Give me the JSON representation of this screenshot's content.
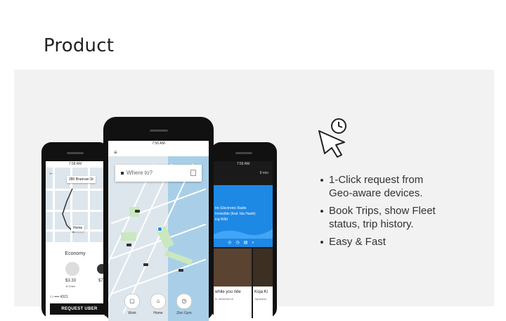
{
  "heading": "Product",
  "left_phone": {
    "status_time": "7:58 AM",
    "address": "280 Brannan St",
    "pin_label": "Home",
    "section": "Economy",
    "price": "$3.33",
    "eta": "8:12am",
    "price2": "$7",
    "card": "•••• 4321",
    "request_button": "REQUEST UBER"
  },
  "center_phone": {
    "status_time": "7:56 AM",
    "search_placeholder": "Where to?",
    "shortcuts": [
      {
        "label": "Work",
        "icon": "briefcase-icon"
      },
      {
        "label": "Home",
        "icon": "home-icon"
      },
      {
        "label": "Zinc Gym",
        "icon": "clock-icon"
      }
    ]
  },
  "right_phone": {
    "status_time": "7:56 AM",
    "eta_label": "8 min",
    "music_line1": "tric Electronic Radio",
    "music_line2": "Invincible (feat. Ida Havik)",
    "music_line3": "ing Wild",
    "card1_title": "while you ride",
    "card1_sub": "ls, delivered at",
    "card2_title": "Koja Ki",
    "card2_sub": "Japanese"
  },
  "features": [
    {
      "line1": "1-Click request from",
      "line2": "Geo-aware devices."
    },
    {
      "line1": "Book Trips, show Fleet",
      "line2": "status, trip history."
    },
    {
      "line1": "Easy & Fast",
      "line2": ""
    }
  ],
  "colors": {
    "accent_blue": "#1e88e5",
    "panel_bg": "#f2f2f2",
    "map_park": "#c9e8bf",
    "map_water": "#a9cfe8"
  }
}
